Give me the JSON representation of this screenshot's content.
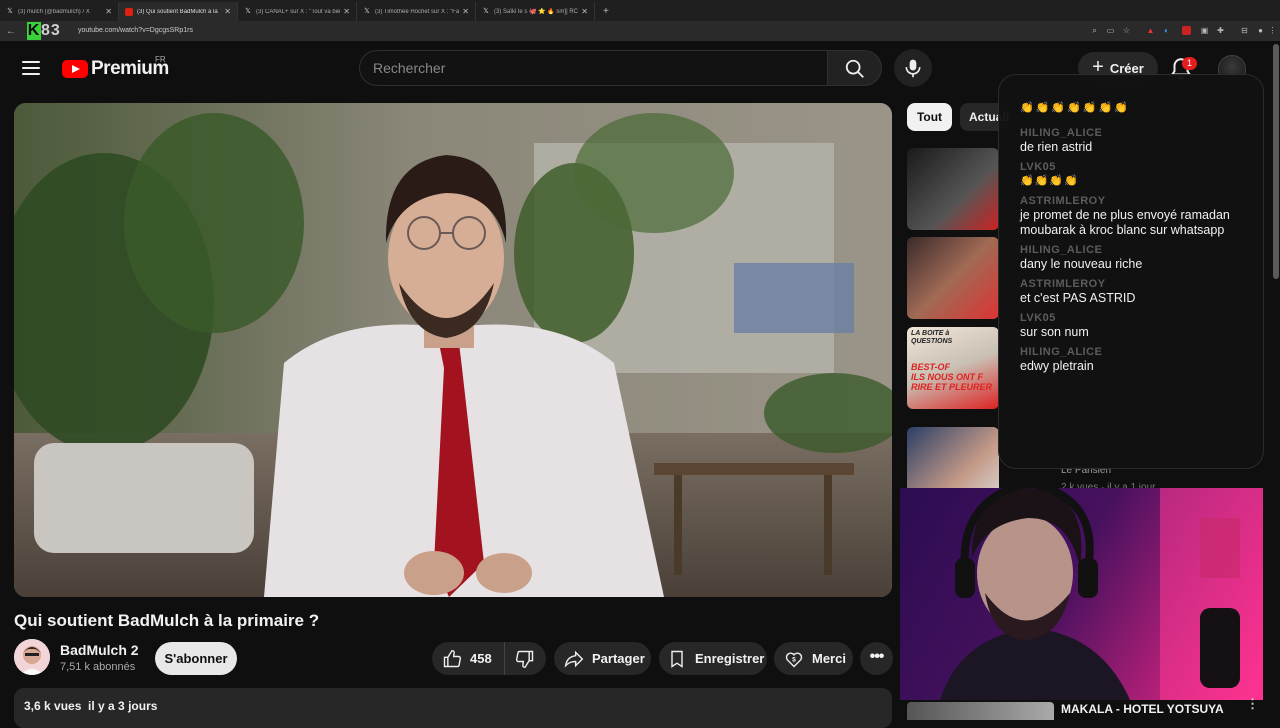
{
  "browser": {
    "tabs": [
      {
        "title": "(3) mulch (@badmulch) / X",
        "icon": "x-icon",
        "active": false
      },
      {
        "title": "(3) Qui soutient BadMulch à la",
        "icon": "youtube-icon",
        "active": true
      },
      {
        "title": "(3) CANAL+ sur X : \"Tout va bie",
        "icon": "x-icon",
        "active": false
      },
      {
        "title": "(3) Timothée Hochet sur X : \"Fai",
        "icon": "x-icon",
        "active": false
      },
      {
        "title": "(3) Saïki le s 🐙 ⭐ 🔥 sm]| RC",
        "icon": "x-icon",
        "active": false
      }
    ],
    "new_tab": "+",
    "url": "youtube.com/watch?v=DgcgsSRp1rs",
    "overlay_logo": {
      "k": "K",
      "rest": "83"
    }
  },
  "header": {
    "logo_word": "Premium",
    "region": "FR",
    "search_placeholder": "Rechercher",
    "create_label": "Créer",
    "notification_count": "1"
  },
  "video": {
    "title": "Qui soutient BadMulch à la primaire ?",
    "channel": "BadMulch 2",
    "subscribers": "7,51 k abonnés",
    "subscribe_label": "S'abonner",
    "likes": "458",
    "share_label": "Partager",
    "save_label": "Enregistrer",
    "thanks_label": "Merci",
    "more_label": "•••",
    "views_and_date": "3,6 k vues  il y a 3 jours"
  },
  "sidebar": {
    "chips": [
      "Tout",
      "Actualités"
    ],
    "rec_channel": "Le Parisien",
    "rec_meta": "2 k vues · il y a 1 jour",
    "thumb_3_lines": [
      "LA BOITE à",
      "QUESTIONS",
      "BEST-OF",
      "ILS NOUS ONT F",
      "RIRE ET PLEURER"
    ],
    "bottom_rec_title": "MAKALA - HOTEL YOTSUYA"
  },
  "chat": {
    "top_emojis": "👏👏👏👏👏👏👏",
    "messages": [
      {
        "user": "HILING_ALICE",
        "text": "de rien astrid"
      },
      {
        "user": "LVK05",
        "text": "👏👏👏👏",
        "emoji": true
      },
      {
        "user": "ASTRIMLEROY",
        "text": "je promet de ne plus envoyé ramadan moubarak à kroc blanc sur whatsapp"
      },
      {
        "user": "HILING_ALICE",
        "text": "dany le nouveau riche"
      },
      {
        "user": "ASTRIMLEROY",
        "text": "et c'est PAS ASTRID"
      },
      {
        "user": "LVK05",
        "text": "sur son num"
      },
      {
        "user": "HILING_ALICE",
        "text": "edwy pletrain"
      }
    ]
  },
  "colors": {
    "background": "#0f0f0f",
    "youtube_red": "#ff0000",
    "chip_active": "#f1f1f1",
    "pill_bg": "#272727",
    "chat_username": "#5c5c5c",
    "webcam_magenta": "#ff2a8a"
  }
}
